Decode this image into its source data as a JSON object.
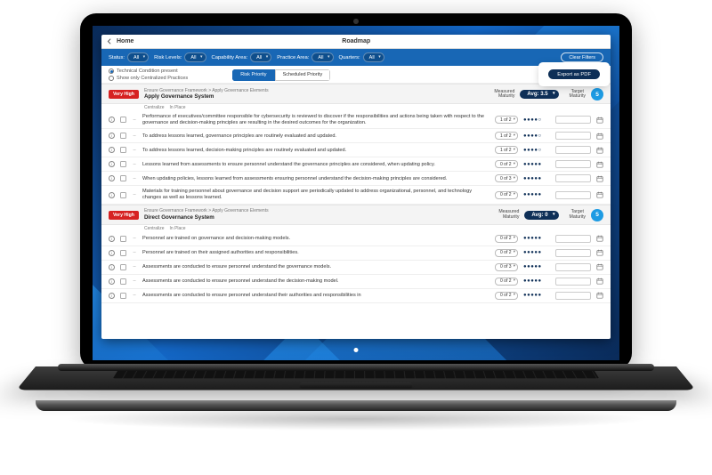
{
  "titlebar": {
    "home": "Home",
    "title": "Roadmap"
  },
  "filters": {
    "status": {
      "label": "Status:",
      "value": "All"
    },
    "risk": {
      "label": "Risk Levels:",
      "value": "All"
    },
    "cap": {
      "label": "Capability Area:",
      "value": "All"
    },
    "prac": {
      "label": "Practice Area:",
      "value": "All"
    },
    "qtr": {
      "label": "Quarters:",
      "value": "All"
    },
    "clear": "Clear Filters"
  },
  "subbar": {
    "opt1": "Technical Condition present",
    "opt2": "Show only Centralized Practices",
    "seg_a": "Risk Priority",
    "seg_b": "Scheduled Priority",
    "export": "Export as PDF"
  },
  "section_labels": {
    "measured": "Measured\nMaturity",
    "target": "Target\nMaturity",
    "centralize": "Centralize",
    "inplace": "In Place"
  },
  "sections": [
    {
      "risk": "Very High",
      "crumb": "Ensure Governance Framework > Apply Governance Elements",
      "title": "Apply Governance System",
      "avg": "Avg: 3.5",
      "target": "5",
      "rows": [
        {
          "text": "Performance of executives/committee responsible for cybersecurity is reviewed to discover if the responsibilities and actions being taken with respect to the governance and decision-making principles are resulting in the desired outcomes for the organization.",
          "count": "1 of 2",
          "dots": "●●●●○"
        },
        {
          "text": "To address lessons learned, governance principles are routinely evaluated and updated.",
          "count": "1 of 2",
          "dots": "●●●●○"
        },
        {
          "text": "To address lessons learned, decision-making principles are routinely evaluated and updated.",
          "count": "1 of 2",
          "dots": "●●●●○"
        },
        {
          "text": "Lessons learned from assessments to ensure personnel understand the governance principles are considered, when updating policy.",
          "count": "0 of 2",
          "dots": "●●●●●"
        },
        {
          "text": "When updating policies, lessons learned from assessments ensuring personnel understand the decision-making principles are considered.",
          "count": "0 of 3",
          "dots": "●●●●●"
        },
        {
          "text": "Materials for training personnel about governance and decision support are periodically updated to address organizational, personnel, and technology changes as well as lessons learned.",
          "count": "0 of 2",
          "dots": "●●●●●"
        }
      ]
    },
    {
      "risk": "Very High",
      "crumb": "Ensure Governance Framework > Apply Governance Elements",
      "title": "Direct Governance System",
      "avg": "Avg: 0",
      "target": "5",
      "rows": [
        {
          "text": "Personnel are trained on governance and decision-making models.",
          "count": "0 of 2",
          "dots": "●●●●●"
        },
        {
          "text": "Personnel are trained on their assigned authorities and responsibilities.",
          "count": "0 of 2",
          "dots": "●●●●●"
        },
        {
          "text": "Assessments are conducted to ensure personnel understand the governance models.",
          "count": "0 of 3",
          "dots": "●●●●●"
        },
        {
          "text": "Assessments are conducted to ensure personnel understand the decision-making model.",
          "count": "0 of 2",
          "dots": "●●●●●"
        },
        {
          "text": "Assessments are conducted to ensure personnel understand their authorities and responsibilities in",
          "count": "0 of 2",
          "dots": "●●●●●"
        }
      ]
    }
  ]
}
